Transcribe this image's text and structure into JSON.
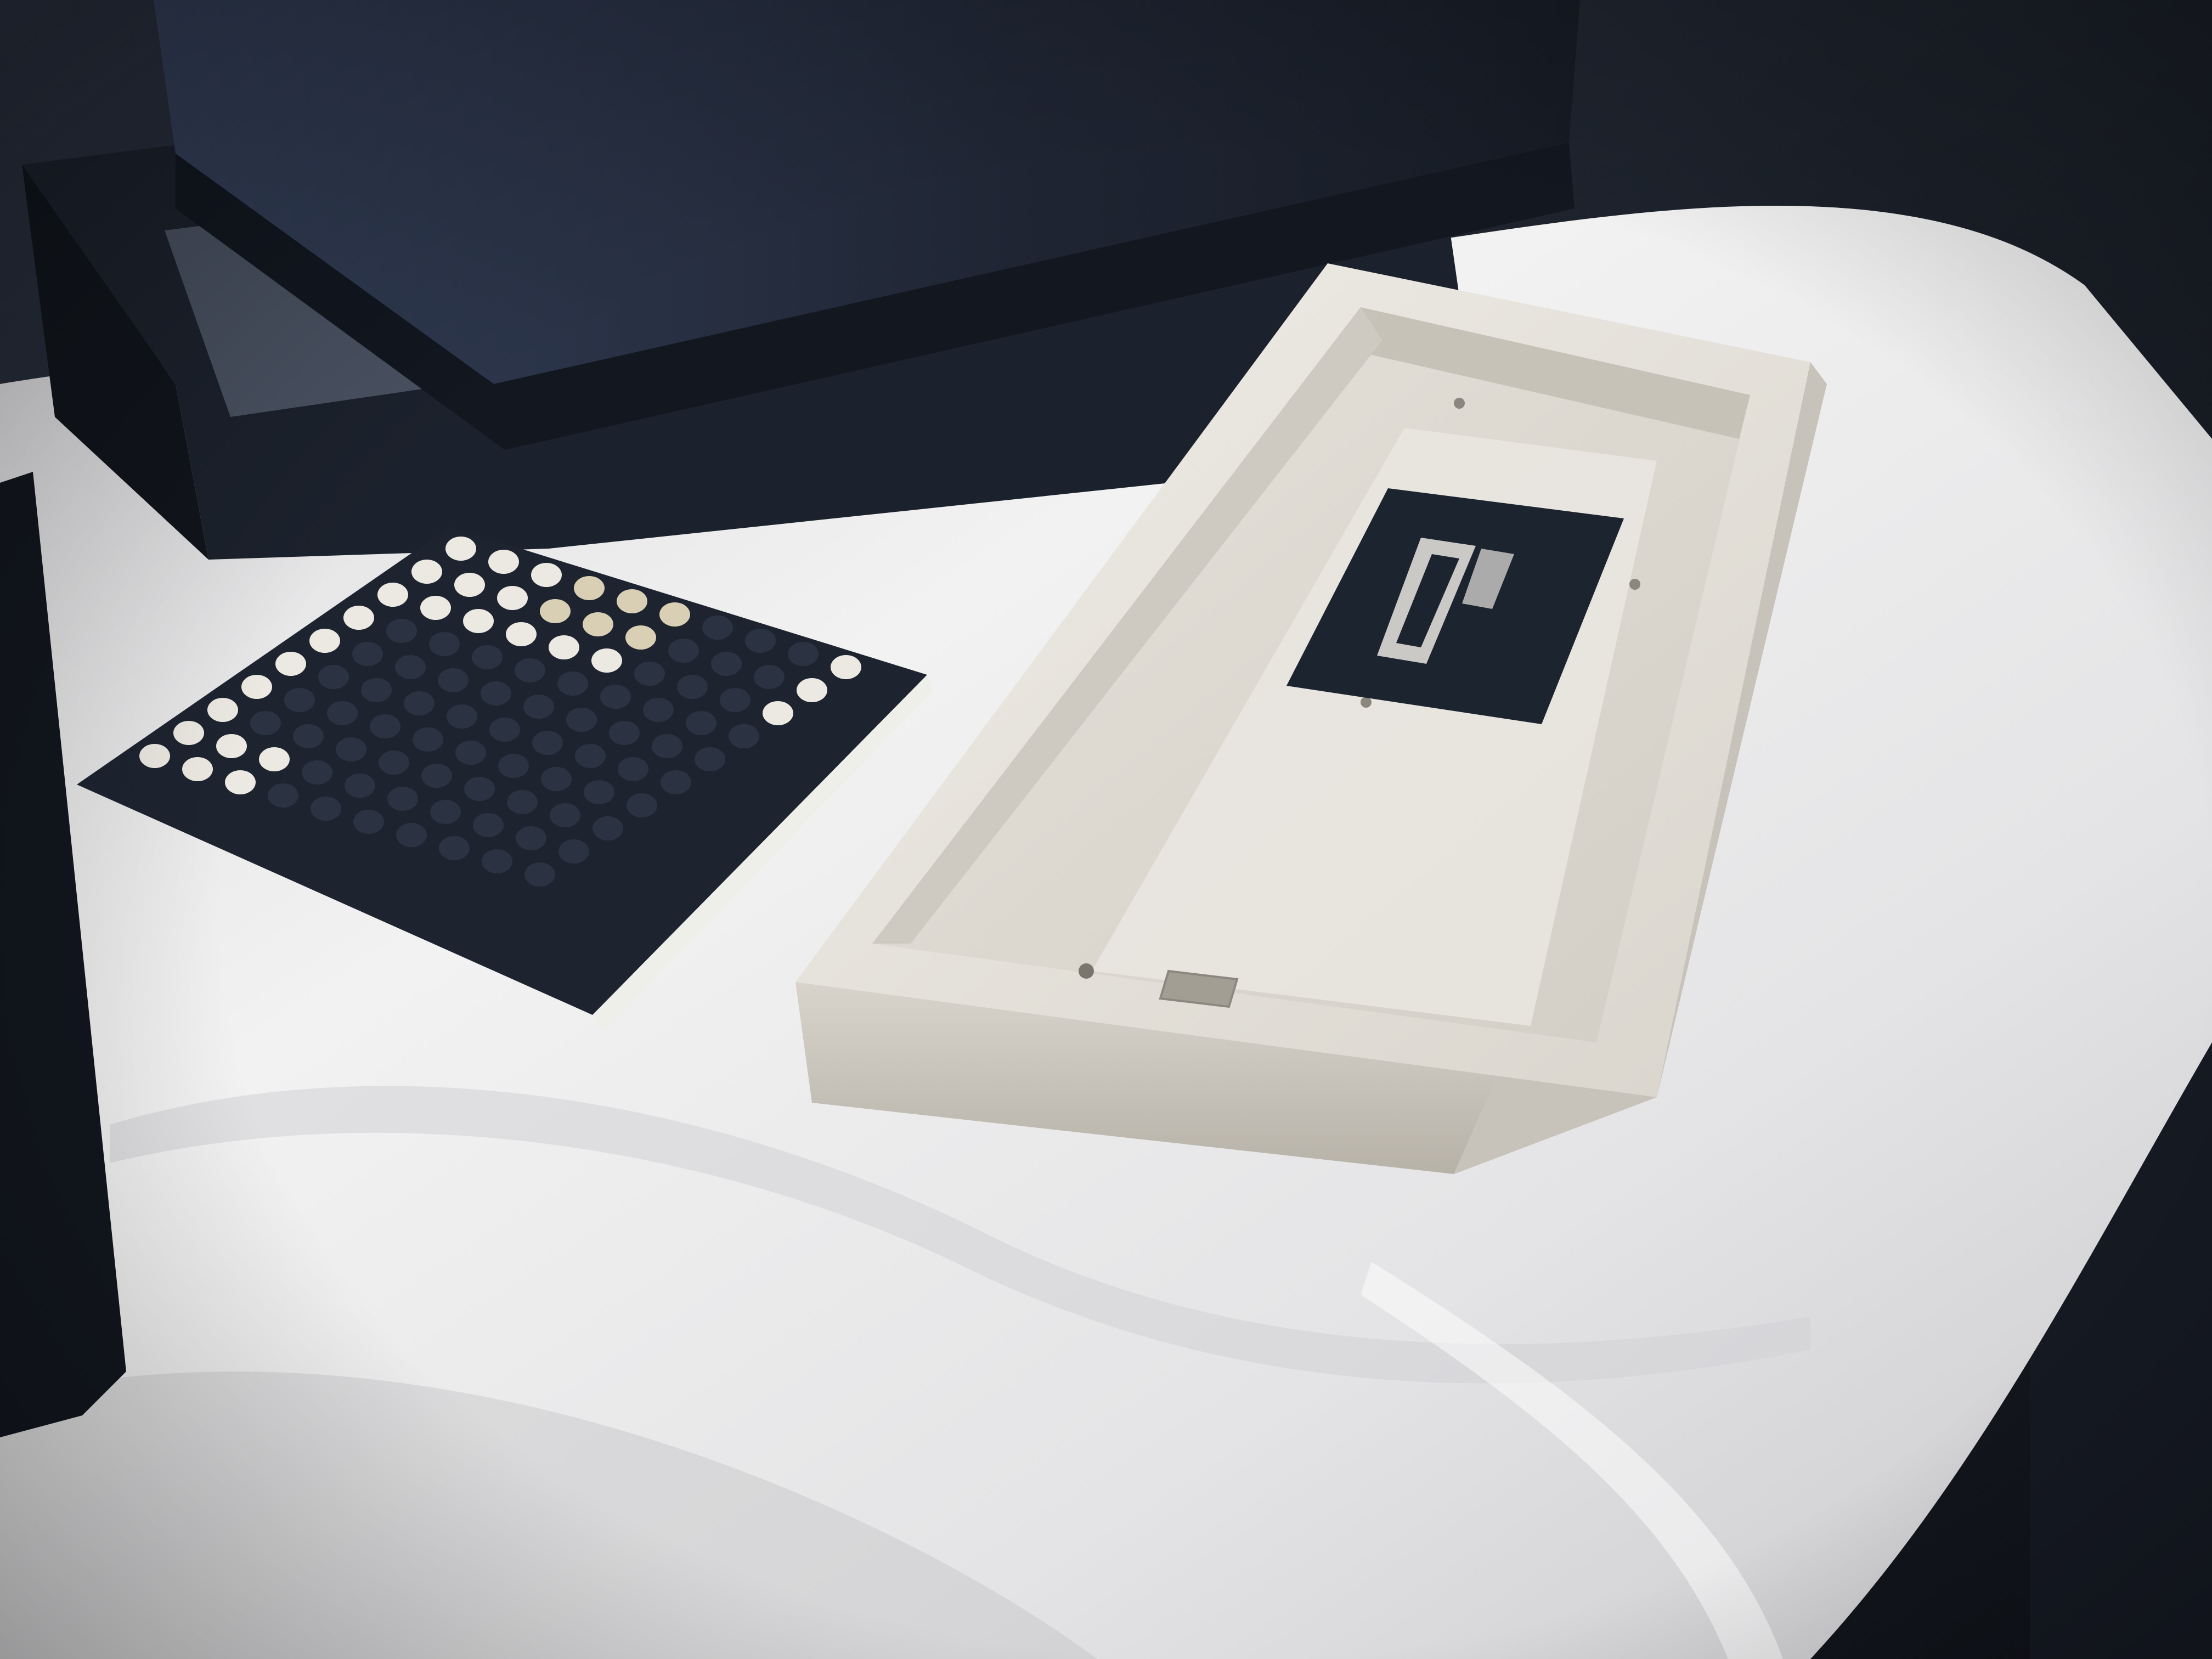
{
  "photo": {
    "subject": "keyboard-case-unboxing",
    "colors": {
      "case": "#e6e2db",
      "case_shadow": "#bdb8ae",
      "case_inner": "#dcd8d0",
      "foam_wrap": "#eeeeee",
      "box": "#1e2532",
      "box_lid": "#2b3445",
      "badge_plate": "#1c2430",
      "bumper_sheet": "#1d2430",
      "bumper_dot_clear": "#ece9e2",
      "bumper_dot_gold": "#d8cfb4",
      "background_dark": "#141820"
    },
    "objects": [
      "shipping-box-lid",
      "shipping-box-base",
      "rubber-bumper-sheet",
      "keyboard-case",
      "case-weight-badge",
      "foam-wrap",
      "usb-port-cutout"
    ]
  }
}
